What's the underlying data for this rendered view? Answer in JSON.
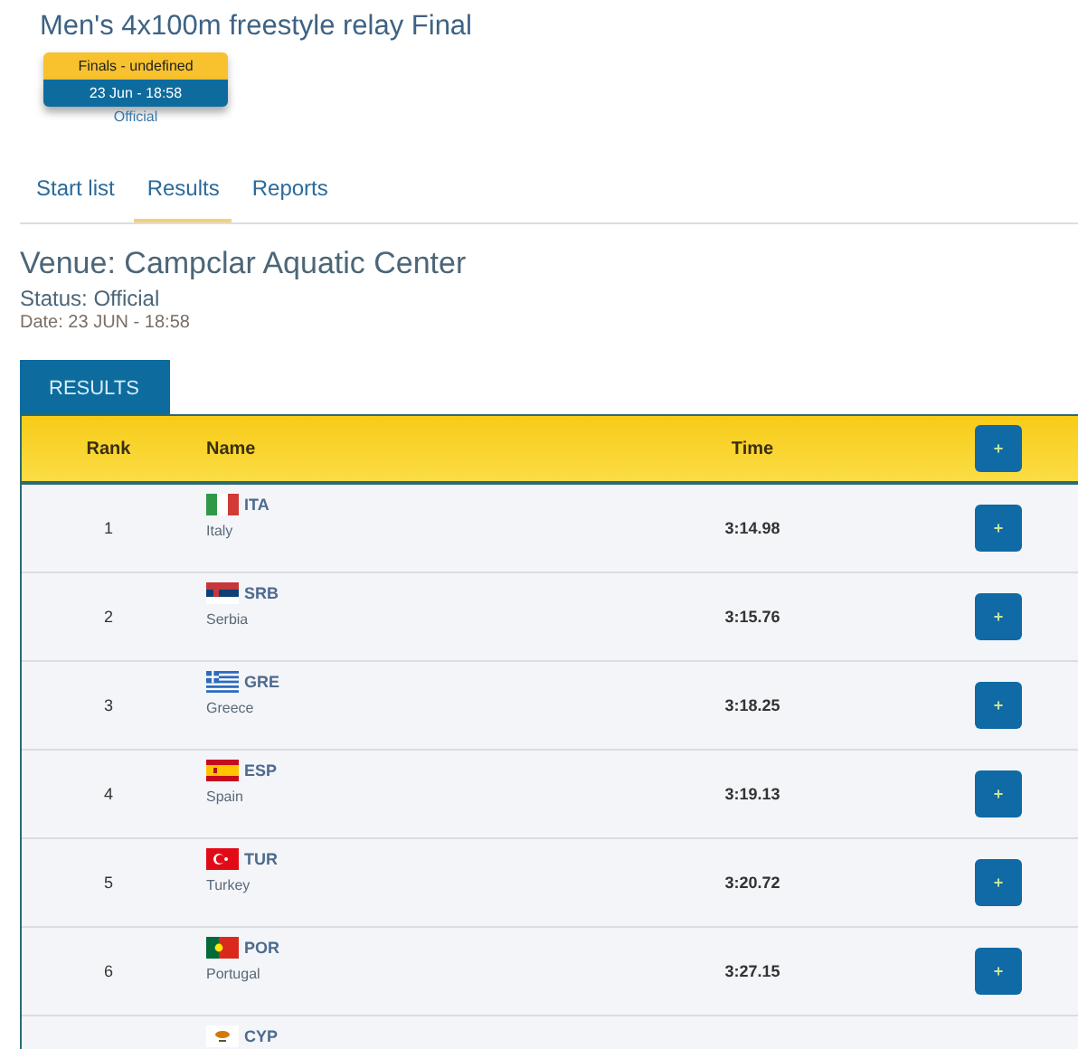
{
  "event": {
    "title": "Men's 4x100m freestyle relay Final",
    "phase": "Finals - undefined",
    "datetime": "23 Jun - 18:58",
    "status": "Official"
  },
  "tabs": [
    {
      "label": "Start list",
      "selected": false
    },
    {
      "label": "Results",
      "selected": true
    },
    {
      "label": "Reports",
      "selected": false
    }
  ],
  "venue": {
    "title": "Venue: Campclar Aquatic Center",
    "status": "Status: Official",
    "date": "Date: 23 JUN - 18:58"
  },
  "results_tab": "RESULTS",
  "table": {
    "columns": [
      "Rank",
      "Name",
      "Time"
    ],
    "header_button": "+",
    "rows": [
      {
        "rank": "1",
        "code": "ITA",
        "country": "Italy",
        "time": "3:14.98",
        "button": "+"
      },
      {
        "rank": "2",
        "code": "SRB",
        "country": "Serbia",
        "time": "3:15.76",
        "button": "+"
      },
      {
        "rank": "3",
        "code": "GRE",
        "country": "Greece",
        "time": "3:18.25",
        "button": "+"
      },
      {
        "rank": "4",
        "code": "ESP",
        "country": "Spain",
        "time": "3:19.13",
        "button": "+"
      },
      {
        "rank": "5",
        "code": "TUR",
        "country": "Turkey",
        "time": "3:20.72",
        "button": "+"
      },
      {
        "rank": "6",
        "code": "POR",
        "country": "Portugal",
        "time": "3:27.15",
        "button": "+"
      },
      {
        "code": "CYP"
      }
    ]
  }
}
